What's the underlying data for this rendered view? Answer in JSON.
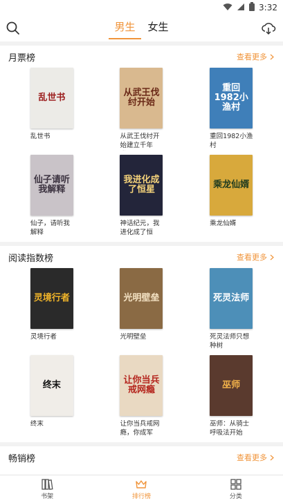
{
  "status": {
    "time": "3:32"
  },
  "header": {
    "tabs": [
      {
        "label": "男生",
        "active": true
      },
      {
        "label": "女生",
        "active": false
      }
    ]
  },
  "sections": [
    {
      "title": "月票榜",
      "more": "查看更多",
      "books": [
        {
          "title": "乱世书",
          "cover_text": "乱世书",
          "bg": "#ecebe7",
          "fg": "#9b1c1c"
        },
        {
          "title": "从武王伐纣开始建立千年世…",
          "cover_text": "从武王伐纣开始",
          "bg": "#d9b98f",
          "fg": "#6b2a18"
        },
        {
          "title": "重回1982小渔村",
          "cover_text": "重回1982小渔村",
          "bg": "#3f7fb9",
          "fg": "#ffffff"
        },
        {
          "title": "仙子，请听我解释",
          "cover_text": "仙子请听我解释",
          "bg": "#c9c3c8",
          "fg": "#3c3340"
        },
        {
          "title": "神话纪元，我进化成了恒星…",
          "cover_text": "我进化成了恒星",
          "bg": "#23253a",
          "fg": "#f4d27a"
        },
        {
          "title": "乘龙仙婿",
          "cover_text": "乘龙仙婿",
          "bg": "#d8a93c",
          "fg": "#1f3b1f"
        }
      ]
    },
    {
      "title": "阅读指数榜",
      "more": "查看更多",
      "books": [
        {
          "title": "灵境行者",
          "cover_text": "灵境行者",
          "bg": "#2a2a2a",
          "fg": "#f0b429"
        },
        {
          "title": "光明壁垒",
          "cover_text": "光明壁垒",
          "bg": "#8a6a44",
          "fg": "#f3e1c2"
        },
        {
          "title": "死灵法师只想种树",
          "cover_text": "死灵法师",
          "bg": "#4d8fb8",
          "fg": "#ffffff"
        },
        {
          "title": "终末",
          "cover_text": "终末",
          "bg": "#f0ede8",
          "fg": "#111111"
        },
        {
          "title": "让你当兵戒网瘾，你成军官…",
          "cover_text": "让你当兵戒网瘾",
          "bg": "#e9d9c2",
          "fg": "#b5261e"
        },
        {
          "title": "巫师：从骑士呼吸法开始肝…",
          "cover_text": "巫师",
          "bg": "#5a3a2e",
          "fg": "#f2b24a"
        }
      ]
    },
    {
      "title": "畅销榜",
      "more": "查看更多",
      "books": []
    }
  ],
  "bottomnav": [
    {
      "label": "书架",
      "icon": "bookshelf-icon",
      "active": false
    },
    {
      "label": "排行榜",
      "icon": "crown-icon",
      "active": true
    },
    {
      "label": "分类",
      "icon": "grid-icon",
      "active": false
    }
  ],
  "colors": {
    "accent": "#f0943a"
  }
}
